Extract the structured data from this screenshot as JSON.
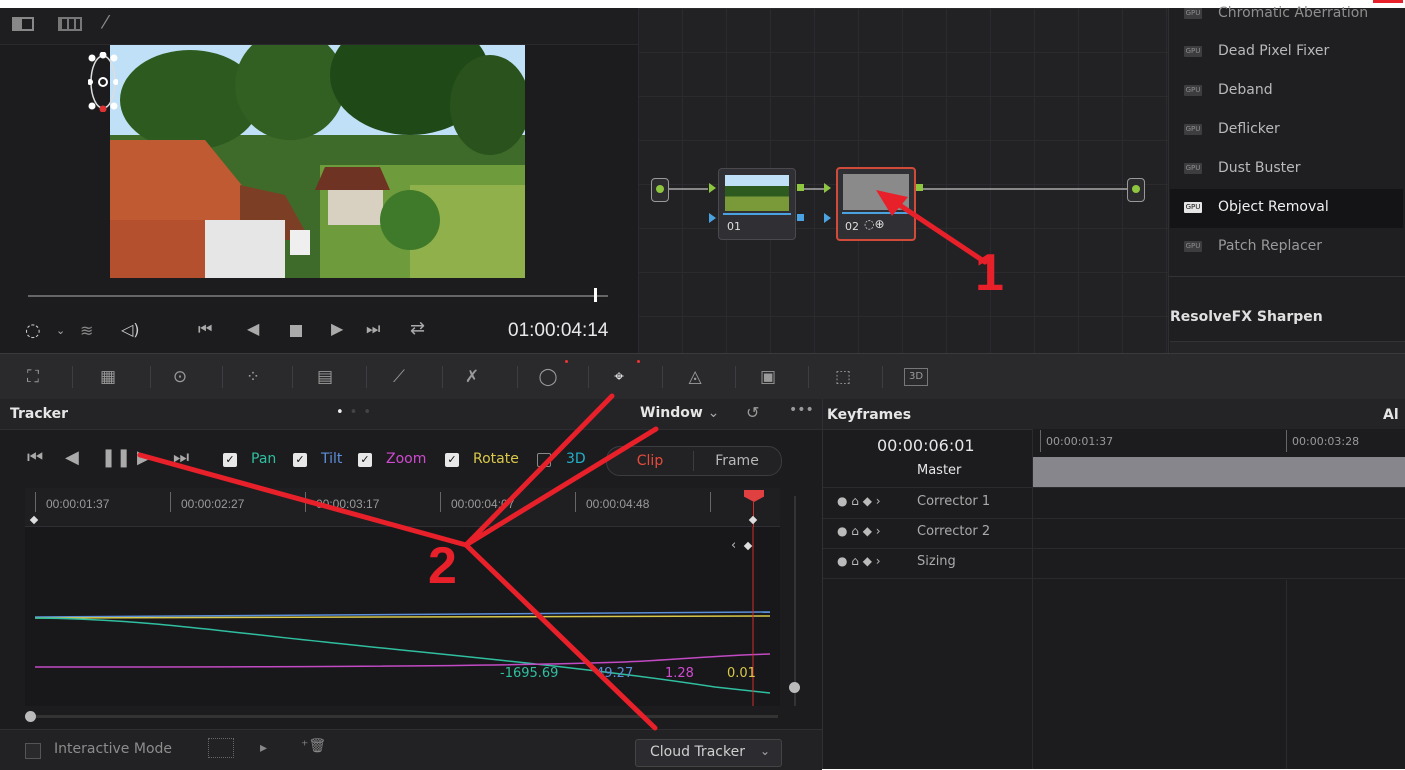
{
  "viewer": {
    "timecode": "01:00:04:14"
  },
  "nodes": [
    {
      "label": "01"
    },
    {
      "label": "02"
    }
  ],
  "annotations": {
    "one": "1",
    "two": "2"
  },
  "fx_list": {
    "items": [
      "Chromatic Aberration",
      "Dead Pixel Fixer",
      "Deband",
      "Deflicker",
      "Dust Buster",
      "Object Removal",
      "Patch Replacer"
    ],
    "selected": "Object Removal",
    "badge": "GPU",
    "section": "ResolveFX Sharpen"
  },
  "tracker": {
    "title": "Tracker",
    "window_menu": "Window",
    "checks": [
      {
        "label": "Pan",
        "color": "#2fbfa0"
      },
      {
        "label": "Tilt",
        "color": "#5b8fd9"
      },
      {
        "label": "Zoom",
        "color": "#d04ad0"
      },
      {
        "label": "Rotate",
        "color": "#d9c84a"
      },
      {
        "label": "3D",
        "color": "#22b0c8"
      }
    ],
    "mode_clip": "Clip",
    "mode_frame": "Frame",
    "ruler": [
      "00:00:01:37",
      "00:00:02:27",
      "00:00:03:17",
      "00:00:04:07",
      "00:00:04:48"
    ],
    "values": [
      {
        "text": "-1695.69",
        "color": "#2fbfa0"
      },
      {
        "text": "49.27",
        "color": "#5b8fd9"
      },
      {
        "text": "1.28",
        "color": "#d04ad0"
      },
      {
        "text": "0.01",
        "color": "#d9c84a"
      }
    ],
    "interactive_mode": "Interactive Mode",
    "cloud_tracker": "Cloud Tracker"
  },
  "keyframes": {
    "title": "Keyframes",
    "title_right": "Al",
    "current": "00:00:06:01",
    "ruler": [
      "00:00:01:37",
      "00:00:03:28"
    ],
    "master": "Master",
    "rows": [
      "Corrector 1",
      "Corrector 2",
      "Sizing"
    ]
  },
  "colors": {
    "accent_red": "#e8202a",
    "panel": "#1c1c1f"
  }
}
